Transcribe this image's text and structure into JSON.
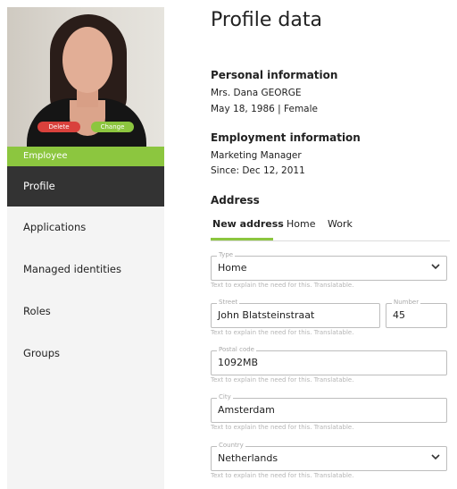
{
  "profile": {
    "delete_label": "Delete",
    "change_label": "Change",
    "role": "Employee"
  },
  "nav": {
    "items": [
      {
        "label": "Profile"
      },
      {
        "label": "Applications"
      },
      {
        "label": "Managed identities"
      },
      {
        "label": "Roles"
      },
      {
        "label": "Groups"
      }
    ]
  },
  "page": {
    "title": "Profile data"
  },
  "personal": {
    "title": "Personal information",
    "name": "Mrs. Dana GEORGE",
    "birth_gender": "May 18, 1986  |  Female"
  },
  "employment": {
    "title": "Employment information",
    "job": "Marketing Manager",
    "since": "Since: Dec 12, 2011"
  },
  "address": {
    "title": "Address",
    "tabs": [
      {
        "label": "New address"
      },
      {
        "label": "Home"
      },
      {
        "label": "Work"
      }
    ],
    "help_text": "Text to explain the need for this. Translatable.",
    "type": {
      "label": "Type",
      "value": "Home"
    },
    "street": {
      "label": "Street",
      "value": "John Blatsteinstraat"
    },
    "number": {
      "label": "Number",
      "value": "45"
    },
    "postal": {
      "label": "Postal code",
      "value": "1092MB"
    },
    "city": {
      "label": "City",
      "value": "Amsterdam"
    },
    "country": {
      "label": "Country",
      "value": "Netherlands"
    }
  },
  "colors": {
    "accent": "#8cc63f",
    "danger": "#d9413c",
    "nav_active": "#333333",
    "sidebar_bg": "#f4f4f4"
  },
  "icons": {
    "select_arrow": "chevron-down-icon"
  }
}
